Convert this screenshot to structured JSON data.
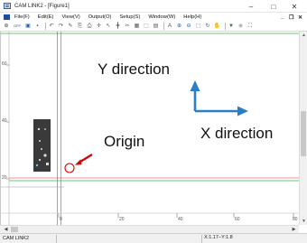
{
  "window": {
    "title": "CAM LINK2 - [Figure1]",
    "minimize_glyph": "–",
    "maximize_glyph": "□",
    "close_glyph": "✕"
  },
  "menubar": {
    "items": [
      "File(F)",
      "Edit(E)",
      "View(V)",
      "Output(O)",
      "Setup(S)",
      "Window(W)",
      "Help(H)"
    ],
    "mdi_minimize": "_",
    "mdi_restore": "❐",
    "mdi_close": "✕"
  },
  "toolbar": {
    "icons": [
      "new-file-icon",
      "open-off-icon",
      "open-folder-icon",
      "save-icon",
      "undo-icon",
      "redo-icon",
      "pen-icon",
      "copy-icon",
      "paste-icon",
      "move-icon",
      "select-icon",
      "crosshair-icon",
      "cut-icon",
      "grid-icon",
      "fit-icon",
      "layer-icon",
      "text-icon",
      "zoom-in-icon",
      "zoom-out-icon",
      "zoom-window-icon",
      "zoom-all-icon",
      "pan-icon",
      "filter-icon",
      "record-icon",
      "fullscreen-icon"
    ],
    "glyphs": [
      "⊕",
      "OFF",
      "▣",
      "▪",
      "↶",
      "↷",
      "✎",
      "⎘",
      "⎙",
      "✛",
      "↖",
      "╋",
      "✂",
      "▦",
      "⬚",
      "▤",
      "A",
      "⊕",
      "⊖",
      "⬚",
      "↻",
      "✋",
      "▼",
      "◉",
      "⛶"
    ]
  },
  "ruler": {
    "x_labels": [
      "0",
      "20",
      "40",
      "60",
      "80"
    ],
    "y_labels": [
      "60",
      "40",
      "20"
    ]
  },
  "annotations": {
    "y_direction": "Y direction",
    "x_direction": "X direction",
    "origin": "Origin"
  },
  "status": {
    "app": "CAM LINK2",
    "coords": "X:1.17−Y:1.8"
  },
  "colors": {
    "accent_arrow": "#2a7ec4",
    "origin_marker": "#e00000",
    "axis_green": "#3bb54a",
    "axis_red": "#e03030"
  }
}
